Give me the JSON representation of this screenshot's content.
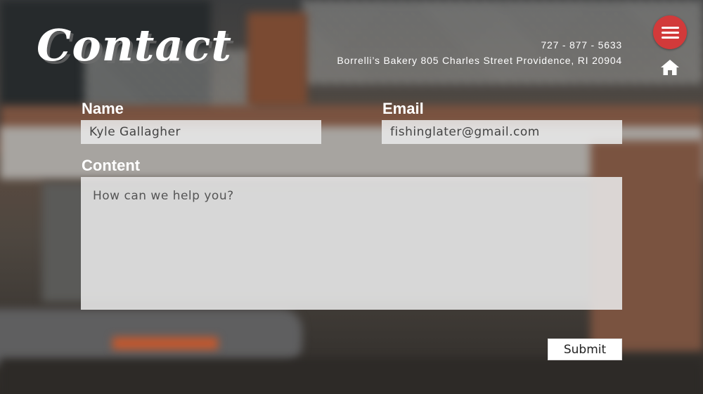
{
  "header": {
    "title": "Contact",
    "phone": "727 - 877 - 5633",
    "address": "Borrelli’s Bakery 805 Charles Street Providence, RI 20904",
    "menu_icon": "hamburger-menu-icon",
    "home_icon": "home-icon"
  },
  "form": {
    "name_label": "Name",
    "name_value": "Kyle Gallagher",
    "email_label": "Email",
    "email_value": "fishinglater@gmail.com",
    "content_label": "Content",
    "content_placeholder": "How can we help you?",
    "submit_label": "Submit"
  },
  "colors": {
    "accent": "#d23a3a",
    "field_bg": "#e8e8e8",
    "text": "#ffffff"
  }
}
